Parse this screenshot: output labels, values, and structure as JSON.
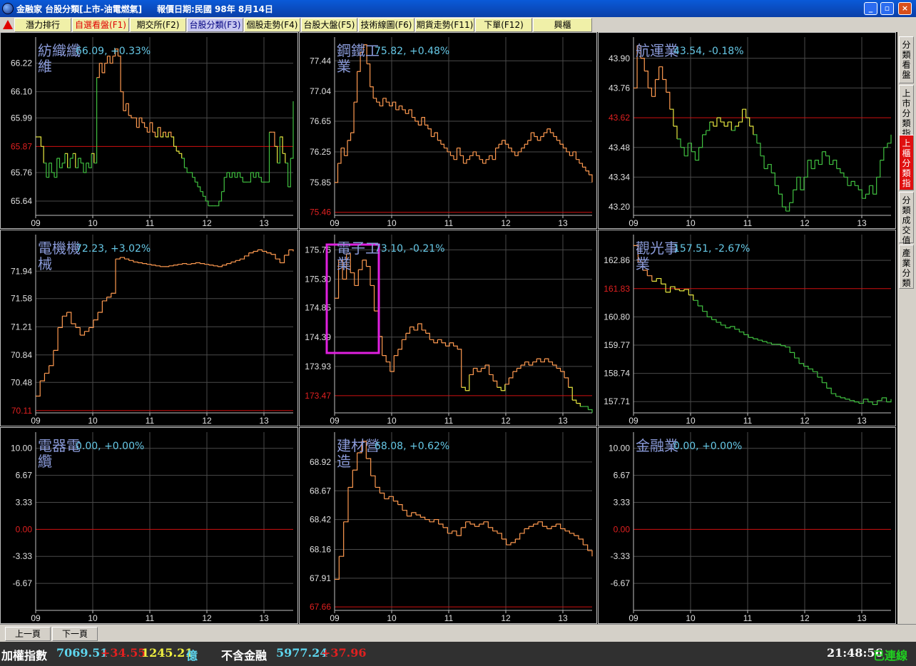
{
  "window": {
    "title": "金融家 台股分類[上市-油電燃氣]     報價日期:民國 98年 8月14日",
    "btn_min": "_",
    "btn_max": "▫",
    "btn_close": "×"
  },
  "tabs": [
    {
      "label": "潛力排行",
      "color": "#000000",
      "bg": "#f0f0a8"
    },
    {
      "label": "自選看盤(F1)",
      "color": "#e00000",
      "bg": "#f0f0a8"
    },
    {
      "label": "期交所(F2)",
      "color": "#000000",
      "bg": "#f0f0a8"
    },
    {
      "label": "台股分類(F3)",
      "color": "#000080",
      "bg": "#c8c8f0"
    },
    {
      "label": "個股走勢(F4)",
      "color": "#000000",
      "bg": "#f0f0a8"
    },
    {
      "label": "台股大盤(F5)",
      "color": "#000000",
      "bg": "#f0f0a8"
    },
    {
      "label": "技術線圖(F6)",
      "color": "#000000",
      "bg": "#f0f0a8"
    },
    {
      "label": "期貨走勢(F11)",
      "color": "#000000",
      "bg": "#f0f0a8"
    },
    {
      "label": "下單(F12)",
      "color": "#000000",
      "bg": "#f0f0a8"
    },
    {
      "label": "興櫃",
      "color": "#000000",
      "bg": "#f0f0a8"
    }
  ],
  "sidebar": [
    {
      "label": "分類看盤",
      "active": false
    },
    {
      "label": "上市分類指",
      "active": false
    },
    {
      "label": "上櫃分類指",
      "active": true
    },
    {
      "label": "分類成交值",
      "active": false
    },
    {
      "label": "產業分類",
      "active": false
    }
  ],
  "pagination": {
    "prev": "上一頁",
    "next": "下一頁"
  },
  "status": {
    "index_label": "加權指數",
    "index_value": "7069.51",
    "index_change": "+34.55",
    "volume": "1245.21",
    "volume_unit": "億",
    "ex_fin_label": "不含金融",
    "ex_fin_value": "5977.24",
    "ex_fin_change": "+37.96",
    "time": "21:48:56",
    "conn": "已連線"
  },
  "colors": {
    "up": "#ff9a50",
    "mid": "#e8e840",
    "down": "#40c040",
    "ref": "#d01010",
    "grid": "#4a4a4a",
    "text_axis": "#e0e0e0",
    "ref_label": "#e02020",
    "highlight": "#e020e0"
  },
  "chart_data": [
    {
      "type": "line",
      "title": "紡織纖維",
      "value": "66.09, +0.33%",
      "x_ticks": [
        "09",
        "10",
        "11",
        "12",
        "13"
      ],
      "y_ticks": [
        "66.22",
        "66.10",
        "65.99",
        "65.87",
        "65.76",
        "65.64"
      ],
      "ref_value": "65.87",
      "ylim": [
        65.58,
        66.33
      ],
      "series": [
        {
          "values": [
            65.91,
            65.91,
            65.87,
            65.8,
            65.74,
            65.8,
            65.76,
            65.74,
            65.82,
            65.78,
            65.8,
            65.84,
            65.78,
            65.82,
            65.84,
            65.78,
            65.82,
            65.8,
            65.76,
            65.8,
            65.78,
            65.84,
            65.8,
            66.16,
            66.22,
            66.18,
            66.22,
            66.25,
            66.22,
            66.25,
            66.28,
            66.25,
            66.1,
            66.02,
            66.05,
            66.0,
            65.99,
            65.99,
            65.95,
            65.99,
            65.97,
            65.95,
            65.93,
            65.97,
            65.93,
            65.91,
            65.95,
            65.91,
            65.93,
            65.91,
            65.93,
            65.91,
            65.87,
            65.85,
            65.84,
            65.82,
            65.78,
            65.76,
            65.76,
            65.74,
            65.72,
            65.7,
            65.68,
            65.66,
            65.64,
            65.62,
            65.62,
            65.62,
            65.62,
            65.64,
            65.68,
            65.74,
            65.76,
            65.74,
            65.76,
            65.74,
            65.76,
            65.74,
            65.72,
            65.72,
            65.72,
            65.76,
            65.74,
            65.76,
            65.74,
            65.72,
            65.72,
            65.72,
            65.93,
            65.93,
            65.87,
            65.8,
            65.91,
            65.84,
            65.8,
            65.7,
            65.82,
            66.06
          ]
        }
      ]
    },
    {
      "type": "line",
      "title": "鋼鐵工業",
      "value": "75.82, +0.48%",
      "x_ticks": [
        "09",
        "10",
        "11",
        "12",
        "13"
      ],
      "y_ticks": [
        "77.44",
        "77.04",
        "76.65",
        "76.25",
        "75.85",
        "75.46"
      ],
      "ref_value": "75.46",
      "ylim": [
        75.42,
        77.75
      ],
      "series": [
        {
          "values": [
            75.85,
            76.1,
            76.3,
            76.2,
            76.4,
            76.5,
            76.9,
            77.3,
            77.55,
            77.65,
            77.4,
            77.1,
            76.95,
            76.9,
            76.85,
            76.95,
            76.9,
            76.85,
            76.9,
            76.8,
            76.85,
            76.8,
            76.75,
            76.8,
            76.7,
            76.65,
            76.6,
            76.7,
            76.6,
            76.55,
            76.45,
            76.5,
            76.4,
            76.35,
            76.3,
            76.25,
            76.2,
            76.15,
            76.3,
            76.2,
            76.1,
            76.15,
            76.2,
            76.25,
            76.2,
            76.15,
            76.1,
            76.15,
            76.2,
            76.15,
            76.3,
            76.35,
            76.4,
            76.35,
            76.3,
            76.25,
            76.2,
            76.25,
            76.3,
            76.35,
            76.4,
            76.5,
            76.45,
            76.4,
            76.45,
            76.5,
            76.55,
            76.5,
            76.45,
            76.4,
            76.35,
            76.3,
            76.25,
            76.2,
            76.25,
            76.15,
            76.1,
            76.05,
            76.0,
            75.95,
            75.85
          ]
        }
      ]
    },
    {
      "type": "line",
      "title": "航運業",
      "value": "43.54, -0.18%",
      "x_ticks": [
        "09",
        "10",
        "11",
        "12",
        "13"
      ],
      "y_ticks": [
        "43.90",
        "43.76",
        "43.62",
        "43.48",
        "43.34",
        "43.20"
      ],
      "ref_value": "43.62",
      "ylim": [
        43.16,
        44.0
      ],
      "series": [
        {
          "values": [
            43.76,
            43.96,
            43.9,
            43.84,
            43.76,
            43.72,
            43.8,
            43.86,
            43.8,
            43.74,
            43.66,
            43.58,
            43.52,
            43.48,
            43.44,
            43.5,
            43.46,
            43.42,
            43.48,
            43.54,
            43.56,
            43.6,
            43.58,
            43.62,
            43.6,
            43.58,
            43.6,
            43.56,
            43.58,
            43.6,
            43.66,
            43.62,
            43.58,
            43.54,
            43.5,
            43.44,
            43.38,
            43.4,
            43.36,
            43.3,
            43.26,
            43.2,
            43.18,
            43.22,
            43.28,
            43.34,
            43.28,
            43.34,
            43.42,
            43.38,
            43.42,
            43.4,
            43.46,
            43.44,
            43.4,
            43.42,
            43.38,
            43.36,
            43.34,
            43.3,
            43.32,
            43.3,
            43.28,
            43.24,
            43.26,
            43.3,
            43.26,
            43.34,
            43.42,
            43.48,
            43.5,
            43.54
          ]
        }
      ]
    },
    {
      "type": "line",
      "title": "電機機械",
      "value": "72.23, +3.02%",
      "x_ticks": [
        "09",
        "10",
        "11",
        "12",
        "13"
      ],
      "y_ticks": [
        "71.94",
        "71.58",
        "71.21",
        "70.84",
        "70.48",
        "70.11"
      ],
      "ref_value": "70.11",
      "ylim": [
        70.08,
        72.42
      ],
      "series": [
        {
          "values": [
            70.3,
            70.5,
            70.6,
            70.7,
            70.9,
            71.2,
            71.35,
            71.4,
            71.25,
            71.2,
            71.1,
            71.15,
            71.2,
            71.3,
            71.4,
            71.55,
            71.6,
            71.65,
            72.1,
            72.12,
            72.1,
            72.08,
            72.06,
            72.05,
            72.04,
            72.03,
            72.02,
            72.01,
            72.0,
            72.0,
            72.01,
            72.02,
            72.03,
            72.04,
            72.03,
            72.04,
            72.05,
            72.04,
            72.03,
            72.02,
            72.01,
            72.0,
            72.02,
            72.04,
            72.06,
            72.08,
            72.1,
            72.14,
            72.18,
            72.2,
            72.22,
            72.2,
            72.18,
            72.16,
            72.1,
            72.05,
            72.15,
            72.22,
            72.2
          ]
        }
      ]
    },
    {
      "type": "line",
      "title": "電子工業",
      "value": "73.10, -0.21%",
      "x_ticks": [
        "09",
        "10",
        "11",
        "12",
        "13"
      ],
      "y_ticks": [
        "175.76",
        "175.30",
        "174.85",
        "174.39",
        "173.93",
        "173.47"
      ],
      "ref_value": "173.47",
      "ylim": [
        173.2,
        176.0
      ],
      "series": [
        {
          "values": [
            175.0,
            175.6,
            175.3,
            175.7,
            175.4,
            175.2,
            175.45,
            175.6,
            175.5,
            175.2,
            174.8,
            174.4,
            174.1,
            174.0,
            173.85,
            174.1,
            174.2,
            174.35,
            174.45,
            174.55,
            174.5,
            174.6,
            174.5,
            174.45,
            174.35,
            174.3,
            174.35,
            174.3,
            174.25,
            174.3,
            174.25,
            174.2,
            173.6,
            173.55,
            173.8,
            173.9,
            173.85,
            173.9,
            173.95,
            173.8,
            173.7,
            173.6,
            173.55,
            173.65,
            173.75,
            173.85,
            173.9,
            173.95,
            174.0,
            173.95,
            174.0,
            174.05,
            174.0,
            174.05,
            174.0,
            173.95,
            173.9,
            173.85,
            173.75,
            173.6,
            173.4,
            173.35,
            173.3,
            173.3,
            173.25,
            173.2
          ]
        }
      ]
    },
    {
      "type": "line",
      "title": "觀光事業",
      "value": "157.51, -2.67%",
      "x_ticks": [
        "09",
        "10",
        "11",
        "12",
        "13"
      ],
      "y_ticks": [
        "162.86",
        "161.83",
        "160.80",
        "159.77",
        "158.74",
        "157.71"
      ],
      "ref_value": "161.83",
      "ylim": [
        157.3,
        163.8
      ],
      "series": [
        {
          "values": [
            163.4,
            162.8,
            162.5,
            162.3,
            162.1,
            162.2,
            162.0,
            161.7,
            161.9,
            161.8,
            161.75,
            161.8,
            161.6,
            161.4,
            161.2,
            161.0,
            160.8,
            160.7,
            160.6,
            160.5,
            160.4,
            160.45,
            160.35,
            160.25,
            160.15,
            160.05,
            160.0,
            159.95,
            159.9,
            159.85,
            159.8,
            159.8,
            159.75,
            159.7,
            159.5,
            159.3,
            159.1,
            159.0,
            158.9,
            158.8,
            158.6,
            158.4,
            158.2,
            158.0,
            157.9,
            157.85,
            157.8,
            157.75,
            157.7,
            157.65,
            157.8,
            157.7,
            157.6,
            157.75,
            157.85,
            157.7,
            157.8
          ]
        }
      ]
    },
    {
      "type": "line",
      "title": "電器電纜",
      "value": "0.00, +0.00%",
      "x_ticks": [
        "09",
        "10",
        "11",
        "12",
        "13"
      ],
      "y_ticks": [
        "10.00",
        "6.67",
        "3.33",
        "0.00",
        "-3.33",
        "-6.67"
      ],
      "ref_value": "0.00",
      "ylim": [
        -10.0,
        12.0
      ],
      "series": []
    },
    {
      "type": "line",
      "title": "建材營造",
      "value": "68.08, +0.62%",
      "x_ticks": [
        "09",
        "10",
        "11",
        "12",
        "13"
      ],
      "y_ticks": [
        "68.92",
        "68.67",
        "68.42",
        "68.16",
        "67.91",
        "67.66"
      ],
      "ref_value": "67.66",
      "ylim": [
        67.63,
        69.18
      ],
      "series": [
        {
          "values": [
            67.9,
            68.1,
            68.4,
            68.7,
            68.85,
            69.0,
            69.1,
            68.95,
            68.8,
            68.7,
            68.65,
            68.6,
            68.62,
            68.58,
            68.55,
            68.5,
            68.45,
            68.48,
            68.46,
            68.44,
            68.42,
            68.4,
            68.42,
            68.38,
            68.35,
            68.3,
            68.32,
            68.28,
            68.35,
            68.4,
            68.38,
            68.36,
            68.38,
            68.4,
            68.35,
            68.32,
            68.3,
            68.25,
            68.2,
            68.22,
            68.25,
            68.3,
            68.34,
            68.36,
            68.38,
            68.4,
            68.36,
            68.34,
            68.36,
            68.38,
            68.34,
            68.32,
            68.3,
            68.28,
            68.25,
            68.2,
            68.15,
            68.1
          ]
        }
      ]
    },
    {
      "type": "line",
      "title": "金融業",
      "value": "0.00, +0.00%",
      "x_ticks": [
        "09",
        "10",
        "11",
        "12",
        "13"
      ],
      "y_ticks": [
        "10.00",
        "6.67",
        "3.33",
        "0.00",
        "-3.33",
        "-6.67"
      ],
      "ref_value": "0.00",
      "ylim": [
        -10.0,
        12.0
      ],
      "series": []
    }
  ]
}
